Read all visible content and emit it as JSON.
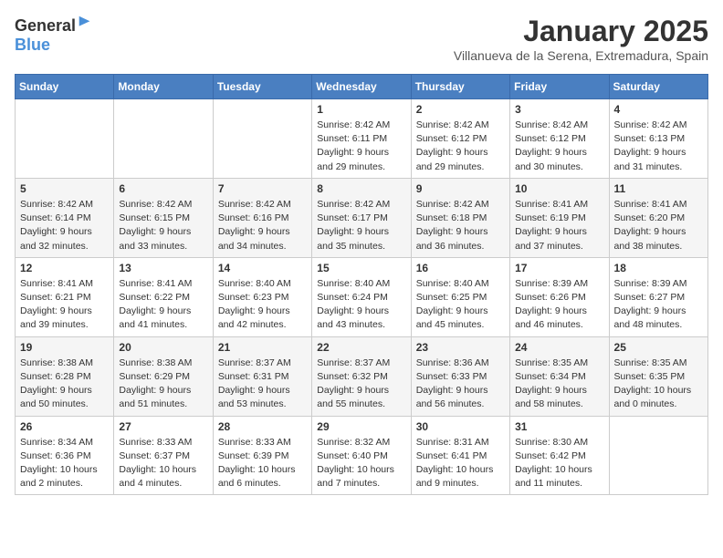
{
  "logo": {
    "general": "General",
    "blue": "Blue"
  },
  "title": "January 2025",
  "location": "Villanueva de la Serena, Extremadura, Spain",
  "days_header": [
    "Sunday",
    "Monday",
    "Tuesday",
    "Wednesday",
    "Thursday",
    "Friday",
    "Saturday"
  ],
  "weeks": [
    [
      {
        "day": "",
        "info": ""
      },
      {
        "day": "",
        "info": ""
      },
      {
        "day": "",
        "info": ""
      },
      {
        "day": "1",
        "info": "Sunrise: 8:42 AM\nSunset: 6:11 PM\nDaylight: 9 hours and 29 minutes."
      },
      {
        "day": "2",
        "info": "Sunrise: 8:42 AM\nSunset: 6:12 PM\nDaylight: 9 hours and 29 minutes."
      },
      {
        "day": "3",
        "info": "Sunrise: 8:42 AM\nSunset: 6:12 PM\nDaylight: 9 hours and 30 minutes."
      },
      {
        "day": "4",
        "info": "Sunrise: 8:42 AM\nSunset: 6:13 PM\nDaylight: 9 hours and 31 minutes."
      }
    ],
    [
      {
        "day": "5",
        "info": "Sunrise: 8:42 AM\nSunset: 6:14 PM\nDaylight: 9 hours and 32 minutes."
      },
      {
        "day": "6",
        "info": "Sunrise: 8:42 AM\nSunset: 6:15 PM\nDaylight: 9 hours and 33 minutes."
      },
      {
        "day": "7",
        "info": "Sunrise: 8:42 AM\nSunset: 6:16 PM\nDaylight: 9 hours and 34 minutes."
      },
      {
        "day": "8",
        "info": "Sunrise: 8:42 AM\nSunset: 6:17 PM\nDaylight: 9 hours and 35 minutes."
      },
      {
        "day": "9",
        "info": "Sunrise: 8:42 AM\nSunset: 6:18 PM\nDaylight: 9 hours and 36 minutes."
      },
      {
        "day": "10",
        "info": "Sunrise: 8:41 AM\nSunset: 6:19 PM\nDaylight: 9 hours and 37 minutes."
      },
      {
        "day": "11",
        "info": "Sunrise: 8:41 AM\nSunset: 6:20 PM\nDaylight: 9 hours and 38 minutes."
      }
    ],
    [
      {
        "day": "12",
        "info": "Sunrise: 8:41 AM\nSunset: 6:21 PM\nDaylight: 9 hours and 39 minutes."
      },
      {
        "day": "13",
        "info": "Sunrise: 8:41 AM\nSunset: 6:22 PM\nDaylight: 9 hours and 41 minutes."
      },
      {
        "day": "14",
        "info": "Sunrise: 8:40 AM\nSunset: 6:23 PM\nDaylight: 9 hours and 42 minutes."
      },
      {
        "day": "15",
        "info": "Sunrise: 8:40 AM\nSunset: 6:24 PM\nDaylight: 9 hours and 43 minutes."
      },
      {
        "day": "16",
        "info": "Sunrise: 8:40 AM\nSunset: 6:25 PM\nDaylight: 9 hours and 45 minutes."
      },
      {
        "day": "17",
        "info": "Sunrise: 8:39 AM\nSunset: 6:26 PM\nDaylight: 9 hours and 46 minutes."
      },
      {
        "day": "18",
        "info": "Sunrise: 8:39 AM\nSunset: 6:27 PM\nDaylight: 9 hours and 48 minutes."
      }
    ],
    [
      {
        "day": "19",
        "info": "Sunrise: 8:38 AM\nSunset: 6:28 PM\nDaylight: 9 hours and 50 minutes."
      },
      {
        "day": "20",
        "info": "Sunrise: 8:38 AM\nSunset: 6:29 PM\nDaylight: 9 hours and 51 minutes."
      },
      {
        "day": "21",
        "info": "Sunrise: 8:37 AM\nSunset: 6:31 PM\nDaylight: 9 hours and 53 minutes."
      },
      {
        "day": "22",
        "info": "Sunrise: 8:37 AM\nSunset: 6:32 PM\nDaylight: 9 hours and 55 minutes."
      },
      {
        "day": "23",
        "info": "Sunrise: 8:36 AM\nSunset: 6:33 PM\nDaylight: 9 hours and 56 minutes."
      },
      {
        "day": "24",
        "info": "Sunrise: 8:35 AM\nSunset: 6:34 PM\nDaylight: 9 hours and 58 minutes."
      },
      {
        "day": "25",
        "info": "Sunrise: 8:35 AM\nSunset: 6:35 PM\nDaylight: 10 hours and 0 minutes."
      }
    ],
    [
      {
        "day": "26",
        "info": "Sunrise: 8:34 AM\nSunset: 6:36 PM\nDaylight: 10 hours and 2 minutes."
      },
      {
        "day": "27",
        "info": "Sunrise: 8:33 AM\nSunset: 6:37 PM\nDaylight: 10 hours and 4 minutes."
      },
      {
        "day": "28",
        "info": "Sunrise: 8:33 AM\nSunset: 6:39 PM\nDaylight: 10 hours and 6 minutes."
      },
      {
        "day": "29",
        "info": "Sunrise: 8:32 AM\nSunset: 6:40 PM\nDaylight: 10 hours and 7 minutes."
      },
      {
        "day": "30",
        "info": "Sunrise: 8:31 AM\nSunset: 6:41 PM\nDaylight: 10 hours and 9 minutes."
      },
      {
        "day": "31",
        "info": "Sunrise: 8:30 AM\nSunset: 6:42 PM\nDaylight: 10 hours and 11 minutes."
      },
      {
        "day": "",
        "info": ""
      }
    ]
  ]
}
